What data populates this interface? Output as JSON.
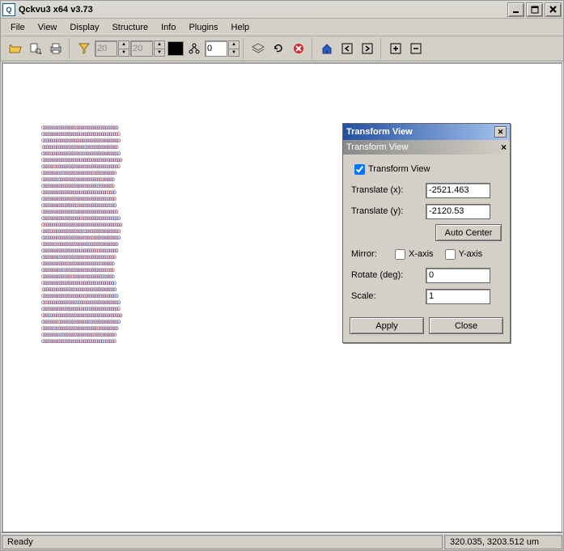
{
  "window": {
    "title": "Qckvu3 x64 v3.73",
    "app_icon_label": "Q"
  },
  "menu": {
    "items": [
      "File",
      "View",
      "Display",
      "Structure",
      "Info",
      "Plugins",
      "Help"
    ]
  },
  "toolbar": {
    "open_icon": "folder-open",
    "preview_icon": "magnifier-page",
    "print_icon": "printer",
    "filter_icon": "funnel",
    "spin1_value": "20",
    "spin2_value": "20",
    "tree_icon": "hierarchy",
    "spin3_value": "0",
    "layers_icon": "layers",
    "refresh_icon": "refresh",
    "stop_icon": "stop",
    "home_icon": "home",
    "nav_left": "←",
    "nav_right": "→",
    "zoom_in": "+",
    "zoom_out": "−"
  },
  "dialog": {
    "title": "Transform View",
    "subtitle": "Transform View",
    "checkbox_label": "Transform View",
    "checkbox_checked": true,
    "translate_x_label": "Translate (x):",
    "translate_x_value": "-2521.463",
    "translate_y_label": "Translate (y):",
    "translate_y_value": "-2120.53",
    "auto_center_label": "Auto Center",
    "mirror_label": "Mirror:",
    "mirror_x_label": "X-axis",
    "mirror_x_checked": false,
    "mirror_y_label": "Y-axis",
    "mirror_y_checked": false,
    "rotate_label": "Rotate (deg):",
    "rotate_value": "0",
    "scale_label": "Scale:",
    "scale_value": "1",
    "apply_label": "Apply",
    "close_label": "Close"
  },
  "status": {
    "left": "Ready",
    "right": "320.035, 3203.512 um"
  },
  "colors": {
    "accent_blue": "#1f5bbf",
    "accent_red": "#d62728",
    "titlebar_gradient_start": "#2450a0",
    "titlebar_gradient_end": "#a6c4f0",
    "chrome": "#d4d0c8"
  }
}
